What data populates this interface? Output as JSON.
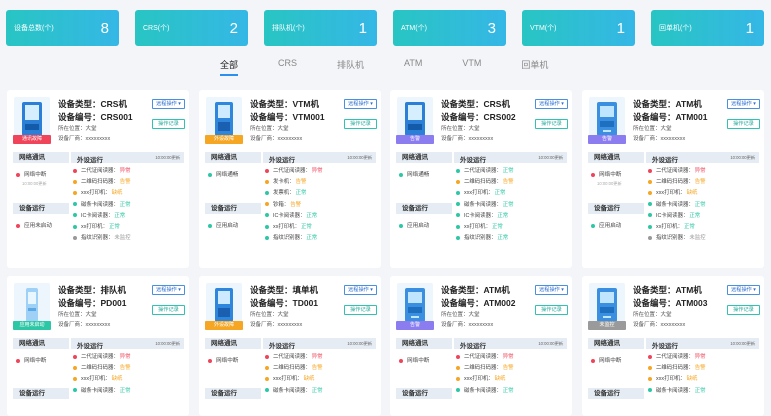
{
  "stats": [
    {
      "label": "设备总数(个)",
      "value": "8"
    },
    {
      "label": "CRS(个)",
      "value": "2"
    },
    {
      "label": "排队机(个)",
      "value": "1"
    },
    {
      "label": "ATM(个)",
      "value": "3"
    },
    {
      "label": "VTM(个)",
      "value": "1"
    },
    {
      "label": "回单机(个)",
      "value": "1"
    }
  ],
  "tabs": [
    "全部",
    "CRS",
    "排队机",
    "ATM",
    "VTM",
    "回单机"
  ],
  "active_tab": "全部",
  "labels": {
    "type_prefix": "设备类型：",
    "code_prefix": "设备编号：",
    "location_prefix": "所在位置：",
    "vendor_prefix": "设备厂商：",
    "remote_button": "远程操作 ▾",
    "log_button": "操作记录",
    "network_header": "网络通讯",
    "peripheral_header": "外设运行",
    "device_run_header": "设备运行",
    "update_time": "10:00:00更新"
  },
  "status_colors": {
    "red": "#f0445a",
    "orange": "#f5a623",
    "green": "#2ec7a5",
    "gray": "#999999"
  },
  "cards": [
    {
      "type": "CRS机",
      "code": "CRS001",
      "location": "大堂",
      "vendor": "xxxxxxxxx",
      "badge": "通讯故障",
      "badge_color": "#f0445a",
      "network": {
        "text": "网络中断",
        "sub": "10:00:00更新",
        "color": "red"
      },
      "device_run": {
        "text": "应用未启动",
        "color": "red"
      },
      "peripherals": [
        {
          "name": "二代证阅读器：",
          "status": "异常",
          "color": "red"
        },
        {
          "name": "二维码扫码器：",
          "status": "告警",
          "color": "orange"
        },
        {
          "name": "xxx打印机：",
          "status": "缺纸",
          "color": "orange"
        },
        {
          "name": "磁条卡阅读器：",
          "status": "正常",
          "color": "green"
        },
        {
          "name": "IC卡阅读器：",
          "status": "正常",
          "color": "green"
        },
        {
          "name": "xx打印机：",
          "status": "正常",
          "color": "green"
        },
        {
          "name": "指纹识别器：",
          "status": "未监控",
          "color": "gray"
        }
      ]
    },
    {
      "type": "VTM机",
      "code": "VTM001",
      "location": "大堂",
      "vendor": "xxxxxxxxx",
      "badge": "外设故障",
      "badge_color": "#f5a623",
      "network": {
        "text": "网络通畅",
        "sub": "",
        "color": "green"
      },
      "device_run": {
        "text": "应用启动",
        "color": "green"
      },
      "peripherals": [
        {
          "name": "二代证阅读器：",
          "status": "异常",
          "color": "red"
        },
        {
          "name": "发卡机：",
          "status": "告警",
          "color": "orange"
        },
        {
          "name": "发票机：",
          "status": "正常",
          "color": "green"
        },
        {
          "name": "钞箱：",
          "status": "告警",
          "color": "orange"
        },
        {
          "name": "IC卡阅读器：",
          "status": "正常",
          "color": "green"
        },
        {
          "name": "xx打印机：",
          "status": "正常",
          "color": "green"
        },
        {
          "name": "指纹识别器：",
          "status": "正常",
          "color": "green"
        }
      ]
    },
    {
      "type": "CRS机",
      "code": "CRS002",
      "location": "大堂",
      "vendor": "xxxxxxxxx",
      "badge": "告警",
      "badge_color": "#8b7cf0",
      "network": {
        "text": "网络通畅",
        "sub": "",
        "color": "green"
      },
      "device_run": {
        "text": "应用启动",
        "color": "green"
      },
      "peripherals": [
        {
          "name": "二代证阅读器：",
          "status": "正常",
          "color": "green"
        },
        {
          "name": "二维码扫码器：",
          "status": "告警",
          "color": "orange"
        },
        {
          "name": "xxx打印机：",
          "status": "正常",
          "color": "green"
        },
        {
          "name": "磁条卡阅读器：",
          "status": "正常",
          "color": "green"
        },
        {
          "name": "IC卡阅读器：",
          "status": "正常",
          "color": "green"
        },
        {
          "name": "xx打印机：",
          "status": "正常",
          "color": "green"
        },
        {
          "name": "指纹识别器：",
          "status": "正常",
          "color": "green"
        }
      ]
    },
    {
      "type": "ATM机",
      "code": "ATM001",
      "location": "大堂",
      "vendor": "xxxxxxxxx",
      "badge": "告警",
      "badge_color": "#8b7cf0",
      "network": {
        "text": "网络中断",
        "sub": "10:00:00更新",
        "color": "red"
      },
      "device_run": {
        "text": "应用启动",
        "color": "green"
      },
      "peripherals": [
        {
          "name": "二代证阅读器：",
          "status": "异常",
          "color": "red"
        },
        {
          "name": "二维码扫码器：",
          "status": "告警",
          "color": "orange"
        },
        {
          "name": "xxx打印机：",
          "status": "缺纸",
          "color": "orange"
        },
        {
          "name": "磁条卡阅读器：",
          "status": "正常",
          "color": "green"
        },
        {
          "name": "IC卡阅读器：",
          "status": "正常",
          "color": "green"
        },
        {
          "name": "xx打印机：",
          "status": "正常",
          "color": "green"
        },
        {
          "name": "指纹识别器：",
          "status": "未监控",
          "color": "gray"
        }
      ]
    },
    {
      "type": "排队机",
      "code": "PD001",
      "location": "大堂",
      "vendor": "xxxxxxxxx",
      "badge": "应用未启动",
      "badge_color": "#2ec7a5",
      "network": {
        "text": "网络中断",
        "sub": "",
        "color": "red"
      },
      "device_run": {
        "text": "",
        "color": "green"
      },
      "peripherals": [
        {
          "name": "二代证阅读器：",
          "status": "异常",
          "color": "red"
        },
        {
          "name": "二维码扫码器：",
          "status": "告警",
          "color": "orange"
        },
        {
          "name": "xxx打印机：",
          "status": "缺纸",
          "color": "orange"
        },
        {
          "name": "磁条卡阅读器：",
          "status": "正常",
          "color": "green"
        }
      ]
    },
    {
      "type": "填单机",
      "code": "TD001",
      "location": "大堂",
      "vendor": "xxxxxxxxx",
      "badge": "外设故障",
      "badge_color": "#f5a623",
      "network": {
        "text": "网络中断",
        "sub": "",
        "color": "red"
      },
      "device_run": {
        "text": "",
        "color": "green"
      },
      "peripherals": [
        {
          "name": "二代证阅读器：",
          "status": "异常",
          "color": "red"
        },
        {
          "name": "二维码扫码器：",
          "status": "告警",
          "color": "orange"
        },
        {
          "name": "xxx打印机：",
          "status": "缺纸",
          "color": "orange"
        },
        {
          "name": "磁条卡阅读器：",
          "status": "正常",
          "color": "green"
        }
      ]
    },
    {
      "type": "ATM机",
      "code": "ATM002",
      "location": "大堂",
      "vendor": "xxxxxxxxx",
      "badge": "告警",
      "badge_color": "#8b7cf0",
      "network": {
        "text": "网络中断",
        "sub": "",
        "color": "red"
      },
      "device_run": {
        "text": "",
        "color": "green"
      },
      "peripherals": [
        {
          "name": "二代证阅读器：",
          "status": "异常",
          "color": "red"
        },
        {
          "name": "二维码扫码器：",
          "status": "告警",
          "color": "orange"
        },
        {
          "name": "xxx打印机：",
          "status": "缺纸",
          "color": "orange"
        },
        {
          "name": "磁条卡阅读器：",
          "status": "正常",
          "color": "green"
        }
      ]
    },
    {
      "type": "ATM机",
      "code": "ATM003",
      "location": "大堂",
      "vendor": "xxxxxxxxx",
      "badge": "未监控",
      "badge_color": "#9a9a9a",
      "network": {
        "text": "网络中断",
        "sub": "",
        "color": "red"
      },
      "device_run": {
        "text": "",
        "color": "green"
      },
      "peripherals": [
        {
          "name": "二代证阅读器：",
          "status": "异常",
          "color": "red"
        },
        {
          "name": "二维码扫码器：",
          "status": "告警",
          "color": "orange"
        },
        {
          "name": "xxx打印机：",
          "status": "缺纸",
          "color": "orange"
        },
        {
          "name": "磁条卡阅读器：",
          "status": "正常",
          "color": "green"
        }
      ]
    }
  ]
}
